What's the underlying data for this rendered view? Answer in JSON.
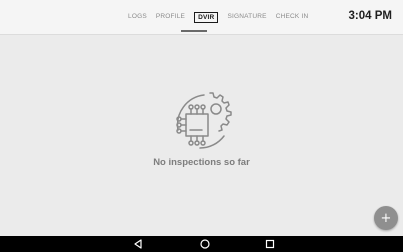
{
  "tabs": [
    {
      "label": "LOGS",
      "active": false
    },
    {
      "label": "PROFILE",
      "active": false
    },
    {
      "label": "DVIR",
      "active": true
    },
    {
      "label": "SIGNATURE",
      "active": false
    },
    {
      "label": "CHECK IN",
      "active": false
    }
  ],
  "status": {
    "time": "3:04 PM"
  },
  "empty_state": {
    "icon": "circuit-gear-icon",
    "message": "No inspections so far"
  },
  "fab": {
    "icon": "plus-icon",
    "label": "+"
  },
  "nav": {
    "back_icon": "back-triangle-icon",
    "home_icon": "home-circle-icon",
    "recents_icon": "recents-square-icon"
  }
}
